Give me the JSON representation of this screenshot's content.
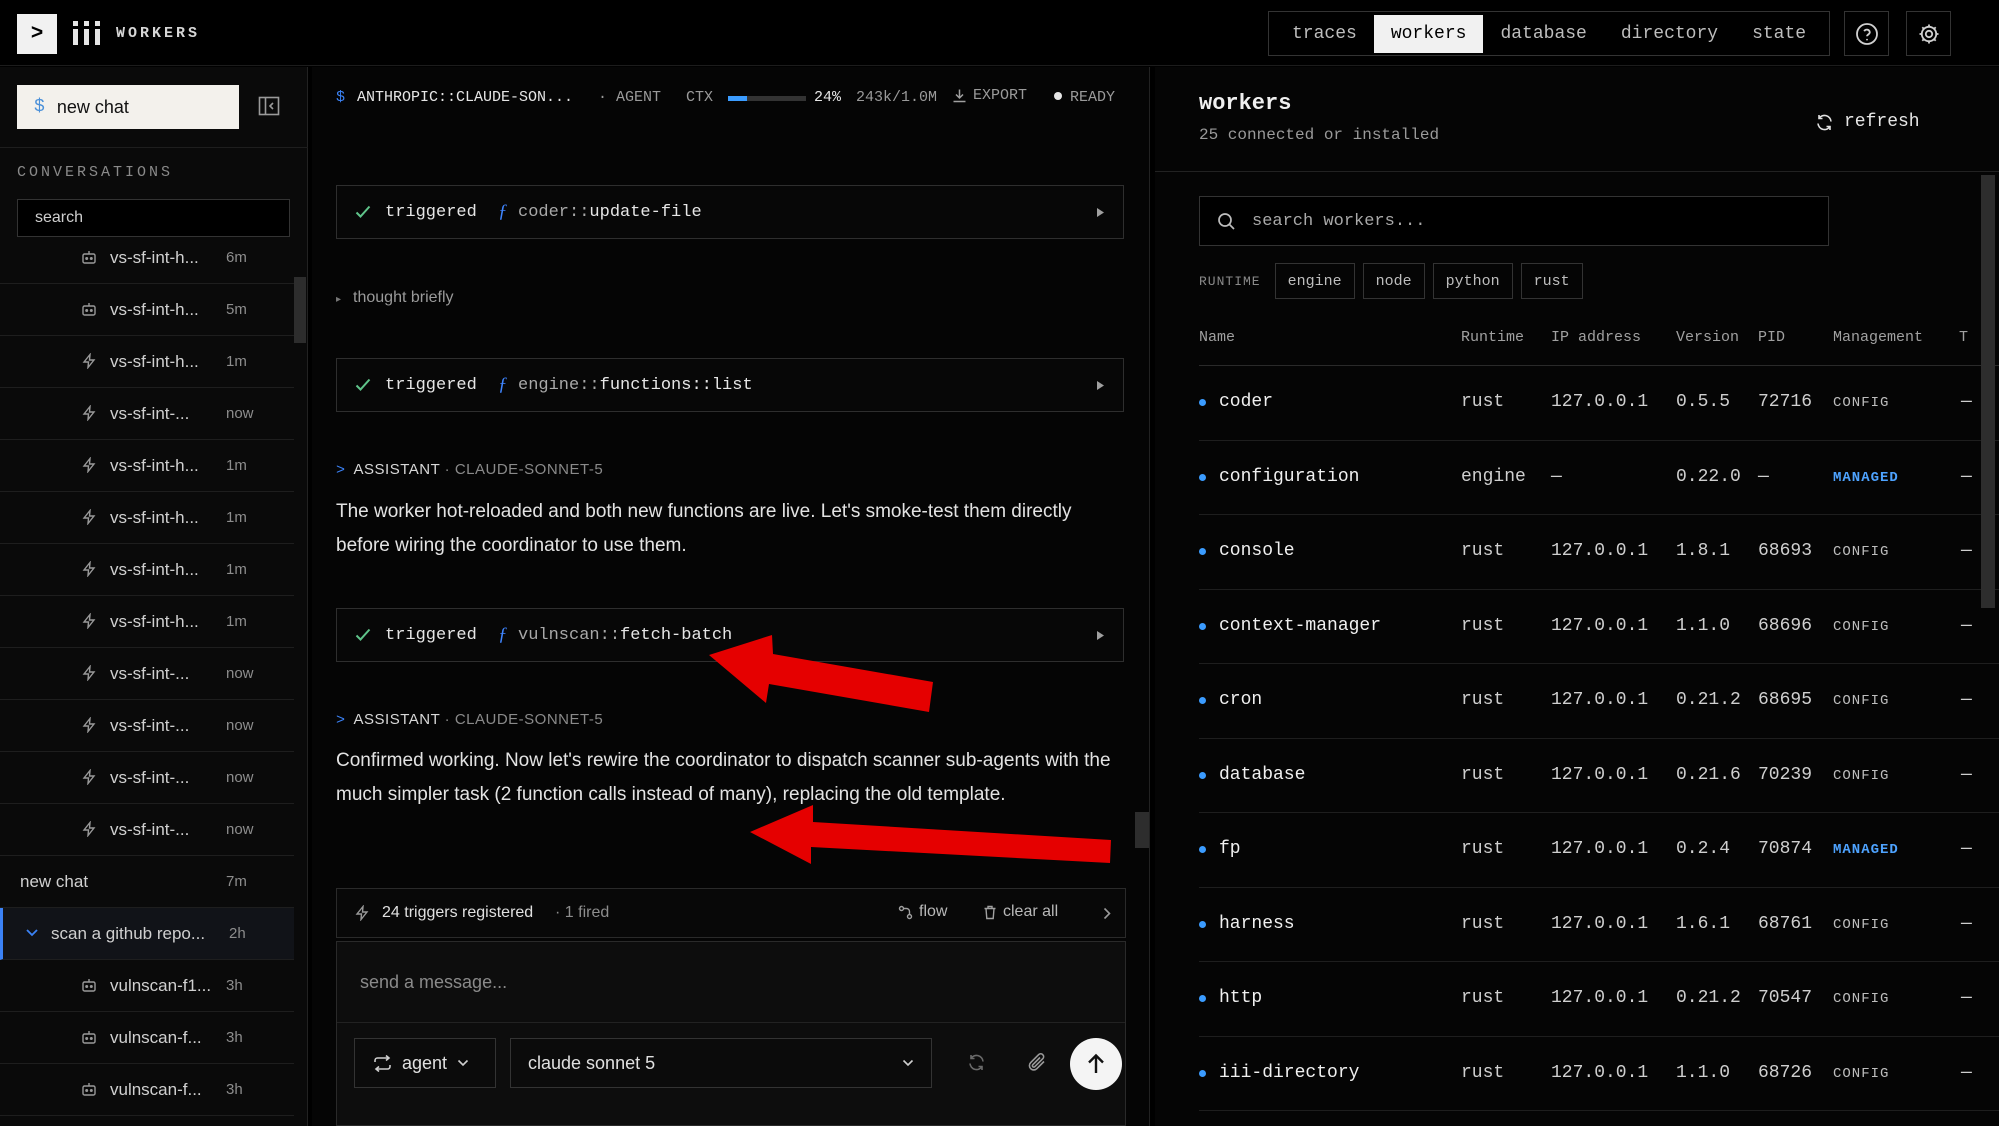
{
  "topbar": {
    "terminal_glyph": ">",
    "brand": "WORKERS",
    "tabs": [
      {
        "label": "traces",
        "active": false
      },
      {
        "label": "workers",
        "active": true
      },
      {
        "label": "database",
        "active": false
      },
      {
        "label": "directory",
        "active": false
      },
      {
        "label": "state",
        "active": false
      }
    ],
    "help_icon": "help-circle-icon",
    "settings_icon": "gear-icon"
  },
  "sidebar": {
    "new_chat_glyph": "$",
    "new_chat_label": "new chat",
    "conversations_heading": "CONVERSATIONS",
    "search_placeholder": "search",
    "items": [
      {
        "icon": "bot-icon",
        "label": "vs-sf-int-h...",
        "time": "6m"
      },
      {
        "icon": "bot-icon",
        "label": "vs-sf-int-h...",
        "time": "5m"
      },
      {
        "icon": "bolt-icon",
        "label": "vs-sf-int-h...",
        "time": "1m"
      },
      {
        "icon": "bolt-icon",
        "label": "vs-sf-int-...",
        "time": "now"
      },
      {
        "icon": "bolt-icon",
        "label": "vs-sf-int-h...",
        "time": "1m"
      },
      {
        "icon": "bolt-icon",
        "label": "vs-sf-int-h...",
        "time": "1m"
      },
      {
        "icon": "bolt-icon",
        "label": "vs-sf-int-h...",
        "time": "1m"
      },
      {
        "icon": "bolt-icon",
        "label": "vs-sf-int-h...",
        "time": "1m"
      },
      {
        "icon": "bolt-icon",
        "label": "vs-sf-int-...",
        "time": "now"
      },
      {
        "icon": "bolt-icon",
        "label": "vs-sf-int-...",
        "time": "now"
      },
      {
        "icon": "bolt-icon",
        "label": "vs-sf-int-...",
        "time": "now"
      },
      {
        "icon": "bolt-icon",
        "label": "vs-sf-int-...",
        "time": "now"
      }
    ],
    "new_chat_item": {
      "label": "new chat",
      "time": "7m"
    },
    "group_item": {
      "label": "scan a github repo...",
      "time": "2h"
    },
    "group_children": [
      {
        "icon": "bot-icon",
        "label": "vulnscan-f1...",
        "time": "3h"
      },
      {
        "icon": "bot-icon",
        "label": "vulnscan-f...",
        "time": "3h"
      },
      {
        "icon": "bot-icon",
        "label": "vulnscan-f...",
        "time": "3h"
      }
    ]
  },
  "chat": {
    "header": {
      "model_glyph": "$",
      "model": "ANTHROPIC::CLAUDE-SON...",
      "mode": "· AGENT",
      "ctx_label": "CTX",
      "ctx_fraction": 0.24,
      "ctx_percent": "24%",
      "ctx_tokens": "243k/1.0M",
      "export_label": "EXPORT",
      "status": "READY"
    },
    "tool_calls": [
      {
        "verb": "triggered",
        "ns": "coder::",
        "fn": "update-file"
      },
      {
        "verb": "triggered",
        "ns": "engine::",
        "fn": "functions::list"
      },
      {
        "verb": "triggered",
        "ns": "vulnscan::",
        "fn": "fetch-batch"
      }
    ],
    "thought": "thought briefly",
    "assistant_1": {
      "role": "ASSISTANT",
      "model": "· CLAUDE-SONNET-5",
      "text": "The worker hot-reloaded and both new functions are live. Let's smoke-test them directly before wiring the coordinator to use them."
    },
    "assistant_2": {
      "role": "ASSISTANT",
      "model": "· CLAUDE-SONNET-5",
      "text": "Confirmed working. Now let's rewire the coordinator to dispatch scanner sub-agents with the much simpler task (2 function calls instead of many), replacing the old template."
    },
    "triggers_bar": {
      "count_label": "24 triggers registered",
      "fired_label": "· 1 fired",
      "flow_label": "flow",
      "clear_label": "clear all"
    },
    "composer": {
      "placeholder": "send a message...",
      "mode_label": "agent",
      "model_label": "claude sonnet 5"
    }
  },
  "workers": {
    "title": "workers",
    "subtitle": "25 connected or installed",
    "refresh_label": "refresh",
    "search_placeholder": "search workers...",
    "runtime_label": "RUNTIME",
    "runtime_filters": [
      "engine",
      "node",
      "python",
      "rust"
    ],
    "columns": [
      "Name",
      "Runtime",
      "IP address",
      "Version",
      "PID",
      "Management",
      "T"
    ],
    "rows": [
      {
        "name": "coder",
        "runtime": "rust",
        "ip": "127.0.0.1",
        "version": "0.5.5",
        "pid": "72716",
        "management": "CONFIG",
        "extra": "—"
      },
      {
        "name": "configuration",
        "runtime": "engine",
        "ip": "—",
        "version": "0.22.0",
        "pid": "—",
        "management": "MANAGED",
        "extra": "—"
      },
      {
        "name": "console",
        "runtime": "rust",
        "ip": "127.0.0.1",
        "version": "1.8.1",
        "pid": "68693",
        "management": "CONFIG",
        "extra": "—"
      },
      {
        "name": "context-manager",
        "runtime": "rust",
        "ip": "127.0.0.1",
        "version": "1.1.0",
        "pid": "68696",
        "management": "CONFIG",
        "extra": "—"
      },
      {
        "name": "cron",
        "runtime": "rust",
        "ip": "127.0.0.1",
        "version": "0.21.2",
        "pid": "68695",
        "management": "CONFIG",
        "extra": "—"
      },
      {
        "name": "database",
        "runtime": "rust",
        "ip": "127.0.0.1",
        "version": "0.21.6",
        "pid": "70239",
        "management": "CONFIG",
        "extra": "—"
      },
      {
        "name": "fp",
        "runtime": "rust",
        "ip": "127.0.0.1",
        "version": "0.2.4",
        "pid": "70874",
        "management": "MANAGED",
        "extra": "—"
      },
      {
        "name": "harness",
        "runtime": "rust",
        "ip": "127.0.0.1",
        "version": "1.6.1",
        "pid": "68761",
        "management": "CONFIG",
        "extra": "—"
      },
      {
        "name": "http",
        "runtime": "rust",
        "ip": "127.0.0.1",
        "version": "0.21.2",
        "pid": "70547",
        "management": "CONFIG",
        "extra": "—"
      },
      {
        "name": "iii-directory",
        "runtime": "rust",
        "ip": "127.0.0.1",
        "version": "1.1.0",
        "pid": "68726",
        "management": "CONFIG",
        "extra": "—"
      }
    ]
  },
  "colors": {
    "accent_blue": "#3b9cff",
    "annotation_red": "#e50000",
    "background": "#000000"
  }
}
